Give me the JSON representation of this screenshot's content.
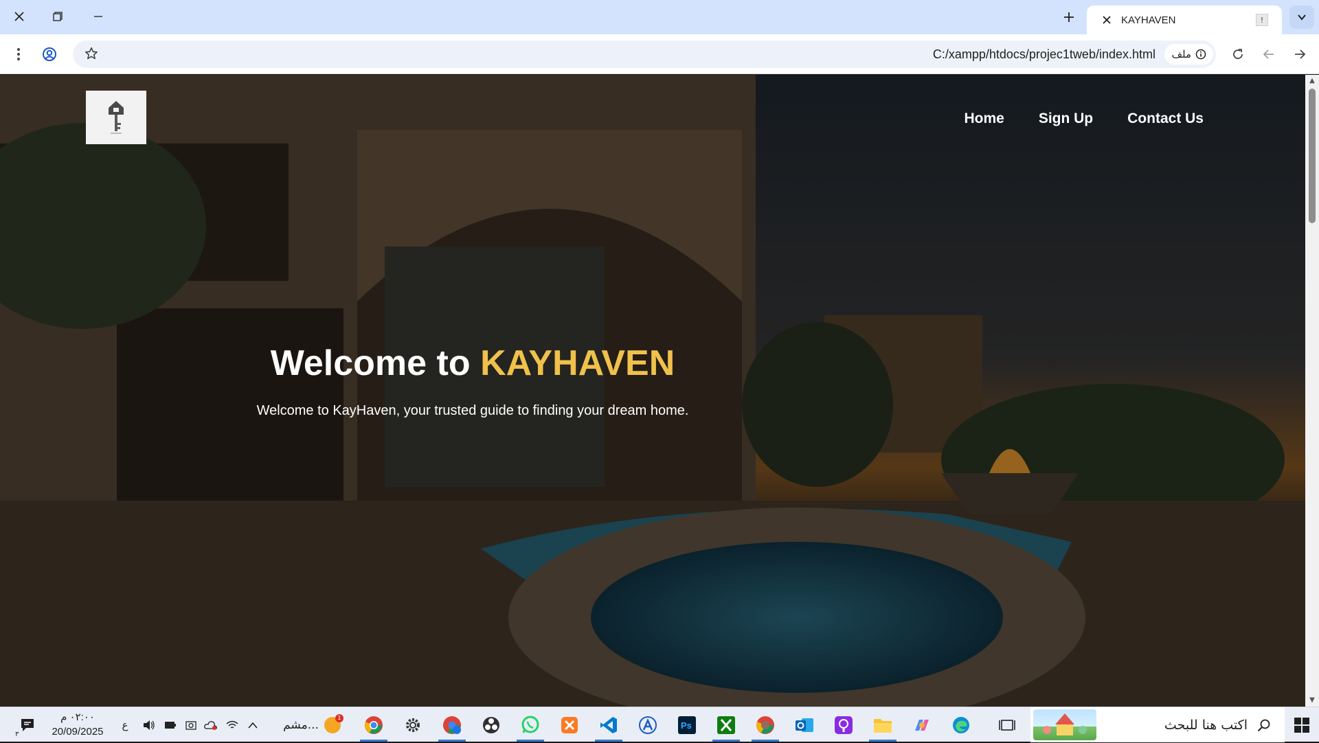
{
  "browser": {
    "tab": {
      "title": "KAYHAVEN",
      "favicon_glyph": "!"
    },
    "omnibox": {
      "url": "C:/xampp/htdocs/projec1tweb/index.html",
      "chip_label": "ملف"
    }
  },
  "page": {
    "nav": {
      "home": "Home",
      "signup": "Sign Up",
      "contact": "Contact Us"
    },
    "headline": {
      "prefix": "Welcome to ",
      "brand": "KAYHAVEN"
    },
    "tagline": "Welcome to KayHaven, your trusted guide to finding your dream home."
  },
  "taskbar": {
    "clock": {
      "time": "٠٢:٠٠ م",
      "date": "20/09/2025"
    },
    "lang": "ع",
    "ticker": {
      "label": "مشم...",
      "badge": "1"
    },
    "search_placeholder": "اكتب هنا للبحث",
    "notification_count": "٣"
  },
  "colors": {
    "brand_accent": "#f0c14b",
    "tabbar_bg": "#d3e3fd",
    "taskbar_bg": "#e9eef6"
  }
}
